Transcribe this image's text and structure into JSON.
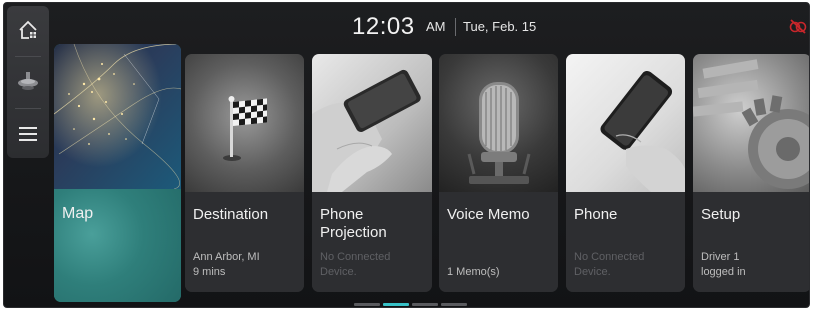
{
  "header": {
    "time": "12:03",
    "ampm": "AM",
    "date": "Tue, Feb. 15"
  },
  "rail": {
    "home_icon": "home-icon",
    "media_icon": "media-icon",
    "menu_icon": "menu-icon"
  },
  "status": {
    "icon": "no-connection-icon",
    "color": "#c8262b"
  },
  "cards": {
    "map": {
      "title": "Map"
    },
    "destination": {
      "title": "Destination",
      "sub1": "Ann Arbor, MI",
      "sub2": "9 mins"
    },
    "phone_projection": {
      "title1": "Phone",
      "title2": "Projection",
      "sub1": "No Connected",
      "sub2": "Device."
    },
    "voice_memo": {
      "title": "Voice Memo",
      "sub": "1 Memo(s)"
    },
    "phone": {
      "title": "Phone",
      "sub1": "No Connected",
      "sub2": "Device."
    },
    "setup": {
      "title": "Setup",
      "sub1": "Driver 1",
      "sub2": "logged in"
    }
  },
  "pager": {
    "pages": 4,
    "active": 2
  },
  "colors": {
    "accent": "#37c1c7",
    "background": "#161719",
    "card": "#2d2e31"
  }
}
